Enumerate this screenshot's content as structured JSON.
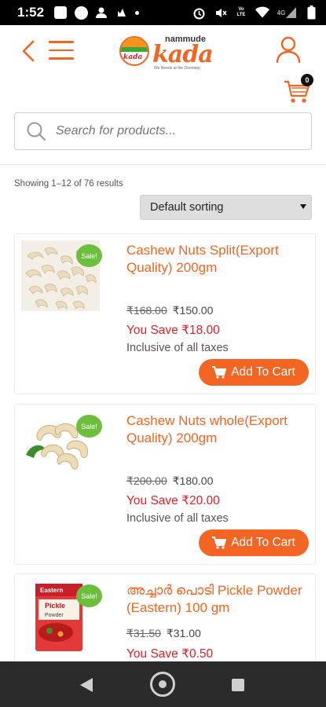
{
  "status_bar": {
    "time": "1:52",
    "left_icons": [
      "message-icon",
      "chat-icon",
      "person-icon",
      "network-icon",
      "dot-icon"
    ],
    "right_icons": [
      "alarm-icon",
      "mute-icon",
      "volte-icon",
      "wifi-icon",
      "signal-4g-icon",
      "battery-icon"
    ],
    "volte_text": "Vo LTE",
    "network_text": "4G"
  },
  "header": {
    "logo_small": "nammude",
    "logo_main": "kada",
    "logo_tag": "We Needs at the Doorstep",
    "logo_circle_text": "kada"
  },
  "cart": {
    "count": "0"
  },
  "search": {
    "placeholder": "Search for products..."
  },
  "results": {
    "count_text": "Showing 1–12 of 76 results",
    "sort_value": "Default sorting"
  },
  "products": [
    {
      "title": "Cashew Nuts Split(Export Quality) 200gm",
      "sale": "Sale!",
      "old_price": "₹168.00",
      "new_price": "₹150.00",
      "save": "You Save ₹18.00",
      "tax": "Inclusive of all taxes",
      "button": "Add To Cart"
    },
    {
      "title": "Cashew Nuts whole(Export Quality) 200gm",
      "sale": "Sale!",
      "old_price": "₹200.00",
      "new_price": "₹180.00",
      "save": "You Save ₹20.00",
      "tax": "Inclusive of all taxes",
      "button": "Add To Cart"
    },
    {
      "title": "അച്ചാർ പൊടി Pickle Powder (Eastern) 100 gm",
      "sale": "Sale!",
      "old_price": "₹31.50",
      "new_price": "₹31.00",
      "save": "You Save ₹0.50",
      "package_brand": "Eastern",
      "package_label": "Pickle",
      "package_sublabel": "Powder"
    }
  ],
  "colors": {
    "accent": "#f26522",
    "save_red": "#e31e24",
    "sale_green": "#6bbf3a",
    "nav_bar": "#2b2b2b"
  }
}
